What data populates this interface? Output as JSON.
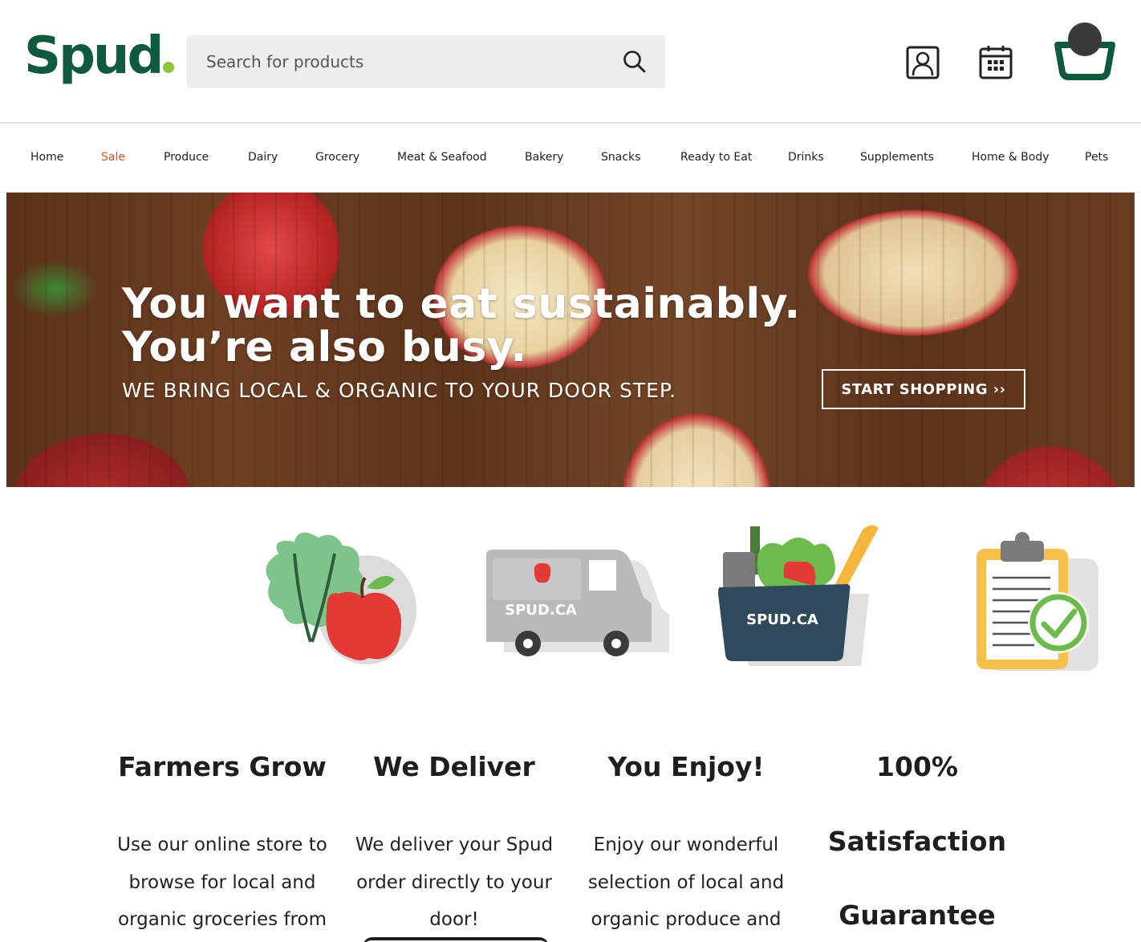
{
  "header": {
    "logo": "Spud",
    "search_placeholder": "Search for products",
    "icons": [
      "search-icon",
      "account-icon",
      "calendar-icon",
      "cart-icon"
    ],
    "colors": {
      "logo_green": "#0d5a3c",
      "logo_dot": "#8cc63f",
      "sale": "#d9531e"
    }
  },
  "nav": {
    "items": [
      "Home",
      "Sale",
      "Produce",
      "Dairy",
      "Grocery",
      "Meat & Seafood",
      "Bakery",
      "Snacks",
      "Ready to Eat",
      "Drinks",
      "Supplements",
      "Home & Body",
      "Pets"
    ]
  },
  "hero": {
    "headline_line1": "You want to eat sustainably.",
    "headline_line2": "You’re also busy.",
    "subheadline": "WE BRING LOCAL & ORGANIC TO YOUR DOOR STEP.",
    "cta": "START SHOPPING ››"
  },
  "features": [
    {
      "title": "Farmers Grow",
      "text": "Use our online store to browse for local and organic groceries from",
      "icon": "produce-icon"
    },
    {
      "title": "We Deliver",
      "text": "We deliver your Spud order directly to your door!",
      "icon": "delivery-truck-icon",
      "van_label": "SPUD.CA"
    },
    {
      "title": "You Enjoy!",
      "text": "Enjoy our wonderful selection of local and organic produce and",
      "icon": "grocery-bag-icon",
      "bag_label": "SPUD.CA"
    },
    {
      "title_line1": "100%",
      "title_line2": "Satisfaction",
      "title_line3": "Guarantee",
      "icon": "clipboard-check-icon"
    }
  ]
}
